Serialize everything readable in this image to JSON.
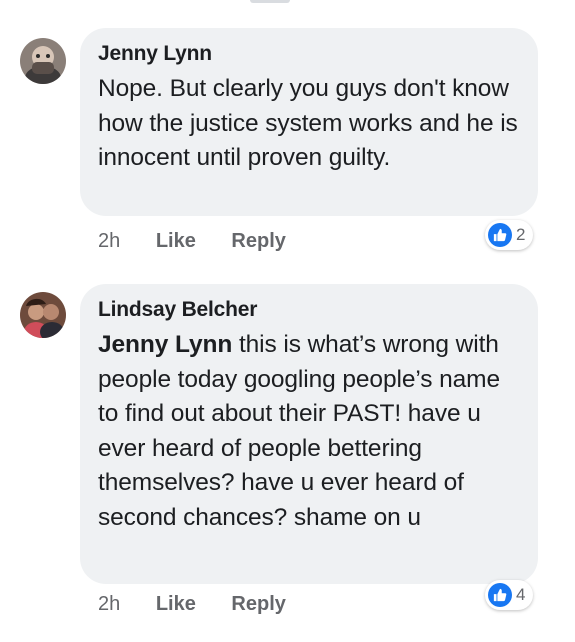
{
  "comments": [
    {
      "author": "Jenny Lynn",
      "text": "Nope. But clearly you guys don't know how the justice system works and he is innocent until proven guilty.",
      "time": "2h",
      "like_label": "Like",
      "reply_label": "Reply",
      "reaction_icon": "like-icon",
      "reaction_count": "2"
    },
    {
      "author": "Lindsay Belcher",
      "mention": "Jenny Lynn",
      "text": "this is what’s wrong with people today googling people’s name to find out about their PAST! have u ever heard of people bettering themselves? have u ever heard of second chances? shame on u",
      "time": "2h",
      "like_label": "Like",
      "reply_label": "Reply",
      "reaction_icon": "like-icon",
      "reaction_count": "4"
    }
  ],
  "colors": {
    "bubble": "#eff1f3",
    "text": "#1c1e21",
    "meta": "#65676b",
    "like_blue": "#1877f2"
  }
}
